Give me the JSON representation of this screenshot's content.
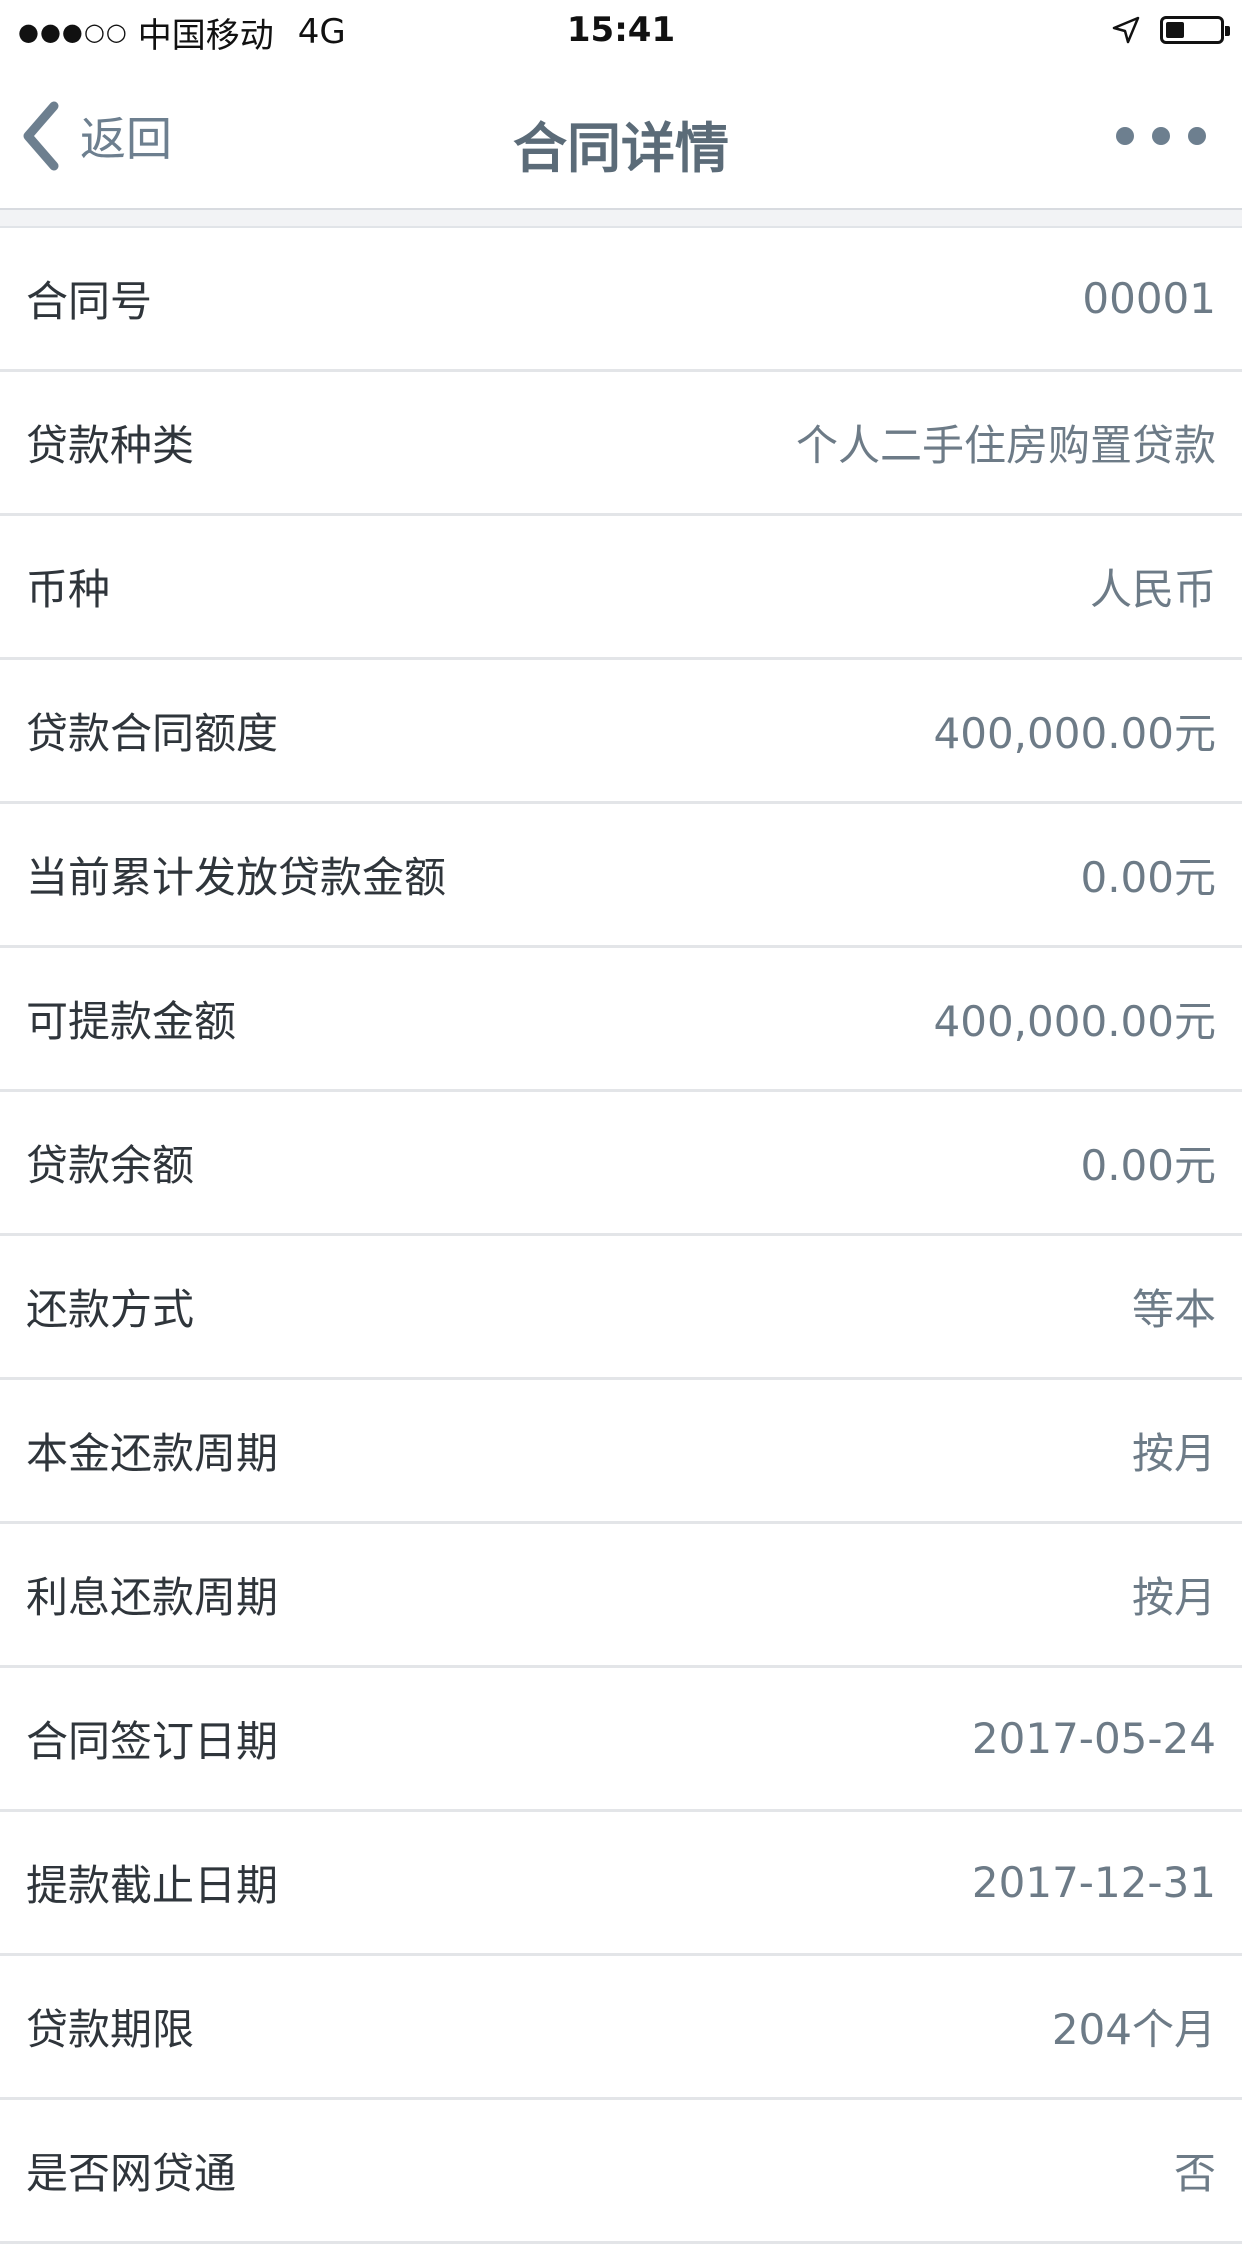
{
  "status_bar": {
    "signal": "●●●○○",
    "carrier": "中国移动",
    "network": "4G",
    "time": "15:41",
    "battery_level": 0.35
  },
  "nav": {
    "back_label": "返回",
    "title": "合同详情"
  },
  "details": [
    {
      "label": "合同号",
      "value": "00001"
    },
    {
      "label": "贷款种类",
      "value": "个人二手住房购置贷款"
    },
    {
      "label": "币种",
      "value": "人民币"
    },
    {
      "label": "贷款合同额度",
      "value": "400,000.00元"
    },
    {
      "label": "当前累计发放贷款金额",
      "value": "0.00元"
    },
    {
      "label": "可提款金额",
      "value": "400,000.00元"
    },
    {
      "label": "贷款余额",
      "value": "0.00元"
    },
    {
      "label": "还款方式",
      "value": "等本"
    },
    {
      "label": "本金还款周期",
      "value": "按月"
    },
    {
      "label": "利息还款周期",
      "value": "按月"
    },
    {
      "label": "合同签订日期",
      "value": "2017-05-24"
    },
    {
      "label": "提款截止日期",
      "value": "2017-12-31"
    },
    {
      "label": "贷款期限",
      "value": "204个月"
    },
    {
      "label": "是否网贷通",
      "value": "否"
    }
  ]
}
